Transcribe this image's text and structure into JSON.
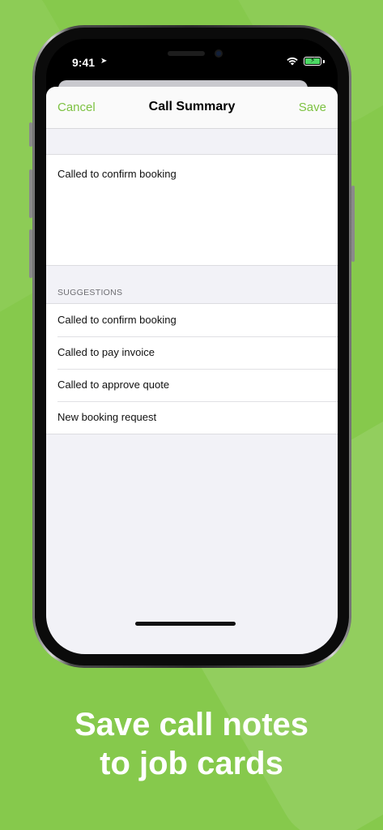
{
  "status_bar": {
    "time": "9:41"
  },
  "nav": {
    "cancel": "Cancel",
    "title": "Call Summary",
    "save": "Save"
  },
  "note": {
    "text": "Called to confirm booking"
  },
  "suggestions": {
    "header": "SUGGESTIONS",
    "items": [
      "Called to confirm booking",
      "Called to pay invoice",
      "Called to approve quote",
      "New booking request"
    ]
  },
  "caption": {
    "line1": "Save call notes",
    "line2": "to job cards"
  },
  "colors": {
    "background": "#86c94c",
    "accent": "#7dc242"
  }
}
